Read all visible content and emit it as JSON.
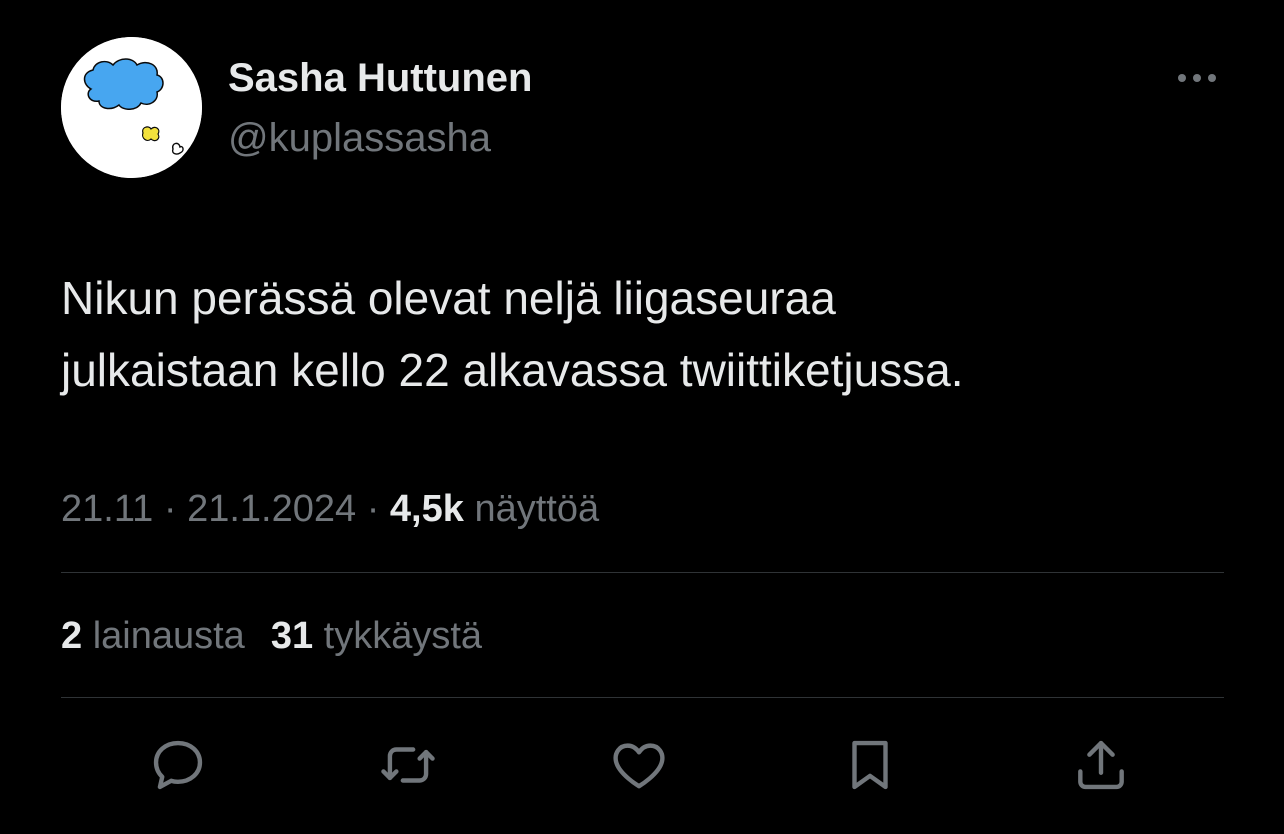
{
  "author": {
    "name": "Sasha Huttunen",
    "handle": "@kuplassasha"
  },
  "tweet": {
    "line1": "Nikun perässä olevat neljä liigaseuraa",
    "line2": "julkaistaan kello 22 alkavassa twiittiketjussa."
  },
  "meta": {
    "time": "21.11",
    "separator": "·",
    "date": "21.1.2024",
    "views_count": "4,5k",
    "views_label": "näyttöä"
  },
  "stats": {
    "quotes_count": "2",
    "quotes_label": "lainausta",
    "likes_count": "31",
    "likes_label": "tykkäystä"
  },
  "icons": {
    "more": "more-horizontal-icon",
    "reply": "reply-bubble-icon",
    "retweet": "retweet-icon",
    "like": "heart-icon",
    "bookmark": "bookmark-icon",
    "share": "share-icon"
  },
  "colors": {
    "background": "#000000",
    "primary_text": "#e7e9ea",
    "secondary_text": "#71767b",
    "divider": "#2f3336",
    "avatar_cloud": "#47a6f0",
    "avatar_accent": "#f2e13c"
  }
}
